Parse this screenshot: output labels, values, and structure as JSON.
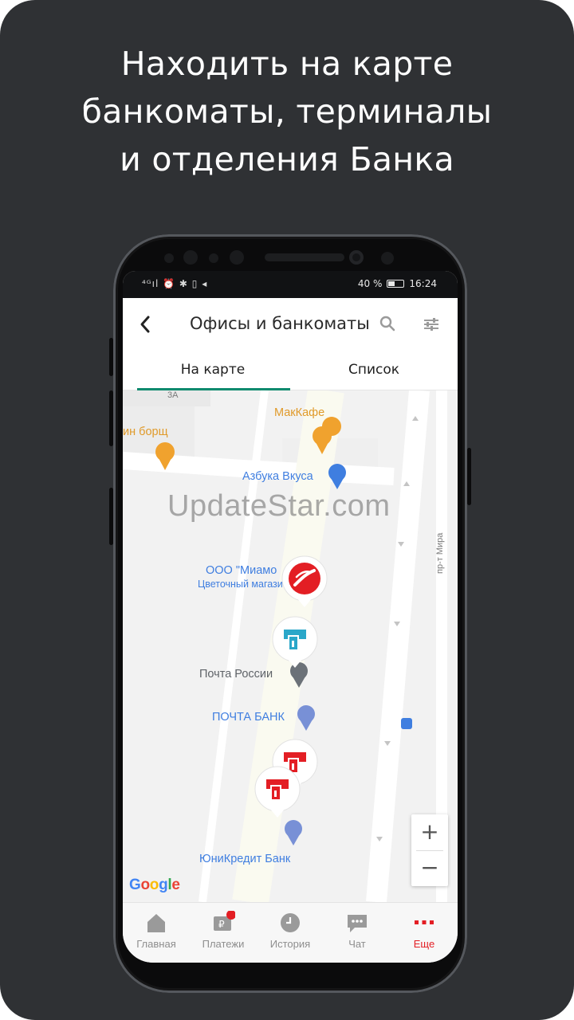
{
  "headline": {
    "line1": "Находить на карте",
    "line2": "банкоматы, терминалы",
    "line3": "и отделения Банка"
  },
  "statusbar": {
    "left_icons": "⁴ᴳıl ⏰ ✱ ▯ ◂",
    "battery_percent": "40 %",
    "time": "16:24"
  },
  "appbar": {
    "title": "Офисы и банкоматы",
    "back_icon": "back-arrow-icon",
    "search_icon": "search-icon",
    "filter_icon": "filter-sliders-icon"
  },
  "tabs": [
    {
      "label": "На карте",
      "active": true
    },
    {
      "label": "Список",
      "active": false
    }
  ],
  "map": {
    "road_labels": [
      "3А",
      "пр-т Мира"
    ],
    "poi": [
      {
        "name": "МакКафе",
        "color": "#f0a22e"
      },
      {
        "name": "ин борщ",
        "color": "#f0a22e"
      },
      {
        "name": "Азбука Вкуса",
        "color": "#3f7ee0"
      },
      {
        "name": "ООО \"Миамо",
        "color": "#3f7ee0"
      },
      {
        "name": "Цветочный магази",
        "color": "#3f7ee0"
      },
      {
        "name": "Почта России",
        "color": "#5f6368"
      },
      {
        "name": "ПОЧТА БАНК",
        "color": "#3f7ee0"
      },
      {
        "name": "ЮниКредит Банк",
        "color": "#3f7ee0"
      }
    ],
    "markers": [
      {
        "type": "bank-office",
        "color": "#e31e24"
      },
      {
        "type": "terminal",
        "color": "#2aa7c9"
      },
      {
        "type": "atm",
        "color": "#e31e24"
      },
      {
        "type": "atm",
        "color": "#e31e24"
      }
    ],
    "watermark": "UpdateStar.com",
    "attribution": "Google",
    "zoom_in": "+",
    "zoom_out": "−"
  },
  "bottom_nav": [
    {
      "label": "Главная",
      "icon": "home-icon",
      "active": false
    },
    {
      "label": "Платежи",
      "icon": "payments-icon",
      "active": false,
      "badge": true
    },
    {
      "label": "История",
      "icon": "history-clock-icon",
      "active": false
    },
    {
      "label": "Чат",
      "icon": "chat-icon",
      "active": false
    },
    {
      "label": "Еще",
      "icon": "more-dots-icon",
      "active": true
    }
  ],
  "colors": {
    "background": "#2f3134",
    "accent_red": "#e31e24",
    "tab_indicator": "#0f8a6e",
    "nav_inactive": "#8e8e8e"
  }
}
